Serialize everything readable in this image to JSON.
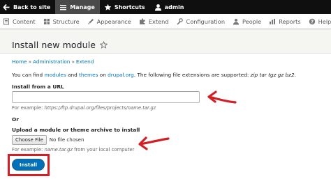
{
  "toolbar": {
    "back_to_site": "Back to site",
    "manage": "Manage",
    "shortcuts": "Shortcuts",
    "user": "admin"
  },
  "tray": {
    "items": [
      {
        "label": "Content",
        "icon": "content-icon"
      },
      {
        "label": "Structure",
        "icon": "structure-icon"
      },
      {
        "label": "Appearance",
        "icon": "appearance-icon"
      },
      {
        "label": "Extend",
        "icon": "extend-icon"
      },
      {
        "label": "Configuration",
        "icon": "configuration-icon"
      },
      {
        "label": "People",
        "icon": "people-icon"
      },
      {
        "label": "Reports",
        "icon": "reports-icon"
      },
      {
        "label": "Help",
        "icon": "help-icon"
      }
    ]
  },
  "page": {
    "title": "Install new module",
    "breadcrumb": [
      "Home",
      "Administration",
      "Extend"
    ],
    "intro_prefix": "You can find ",
    "intro_modules": "modules",
    "intro_and": " and ",
    "intro_themes": "themes",
    "intro_on": " on ",
    "intro_site": "drupal.org",
    "intro_suffix": ". The following file extensions are supported: ",
    "intro_extensions": "zip tar tgz gz bz2",
    "intro_end": "."
  },
  "form": {
    "url_label": "Install from a URL",
    "url_value": "",
    "url_hint_prefix": "For example: ",
    "url_hint_example": "https://ftp.drupal.org/files/projects/name.tar.gz",
    "or_label": "Or",
    "upload_label": "Upload a module or theme archive to install",
    "choose_file": "Choose File",
    "no_file": "No file chosen",
    "upload_hint_prefix": "For example: ",
    "upload_hint_example": "name.tar.gz",
    "upload_hint_suffix": " from your local computer",
    "install_button": "Install"
  },
  "colors": {
    "toolbar_bg": "#0f0f0f",
    "link": "#0074bd",
    "primary_button": "#0071b8",
    "annotation_red": "#d21f26"
  }
}
